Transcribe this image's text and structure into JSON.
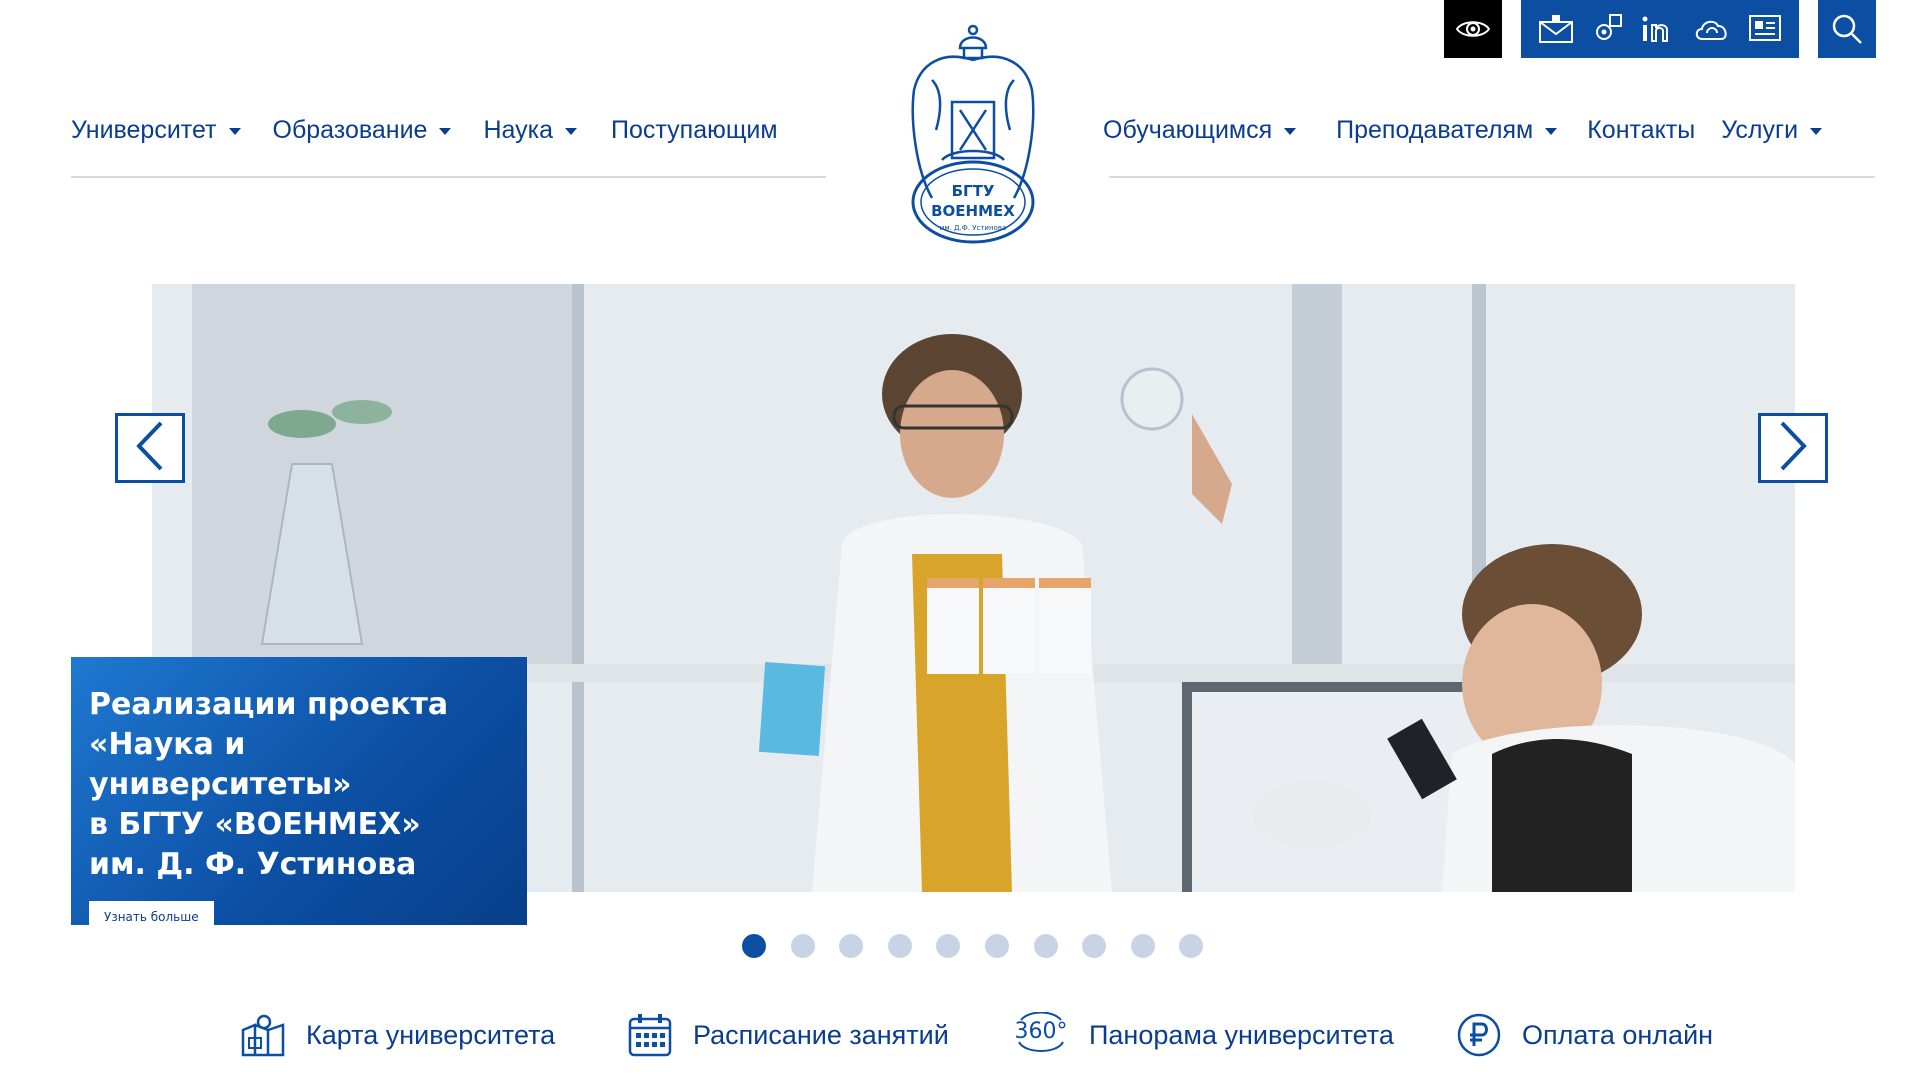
{
  "nav": {
    "left": [
      {
        "label": "Университет",
        "dropdown": true
      },
      {
        "label": "Образование",
        "dropdown": true
      },
      {
        "label": "Наука",
        "dropdown": true
      },
      {
        "label": "Поступающим",
        "dropdown": false
      }
    ],
    "right": [
      {
        "label": "Обучающимся",
        "dropdown": true
      },
      {
        "label": "Преподавателям",
        "dropdown": true
      },
      {
        "label": "Контакты",
        "dropdown": false
      },
      {
        "label": "Услуги",
        "dropdown": true
      }
    ]
  },
  "logo": {
    "line1": "БГТУ",
    "line2": "ВОЕНМЕХ",
    "line3": "им. Д.Ф. Устинова"
  },
  "utility_icons": [
    "eye-icon",
    "mail-icon",
    "support-icon",
    "linkedin-icon",
    "cloud-icon",
    "portal-icon",
    "search-icon"
  ],
  "hero": {
    "caption_title": "Реализации проекта\n«Наука и университеты»\nв БГТУ «ВОЕНМЕХ»\nим. Д. Ф. Устинова",
    "caption_button": "Узнать больше",
    "slide_count": 10,
    "active_slide": 1
  },
  "quick_links": [
    {
      "label": "Карта университета",
      "icon": "map-icon"
    },
    {
      "label": "Расписание занятий",
      "icon": "calendar-icon"
    },
    {
      "label": "Панорама университета",
      "icon": "panorama-360-icon"
    },
    {
      "label": "Оплата онлайн",
      "icon": "ruble-icon"
    }
  ],
  "colors": {
    "brand": "#0b4ea2",
    "text": "#0a3d91",
    "dot_inactive": "#c8d4e6"
  }
}
